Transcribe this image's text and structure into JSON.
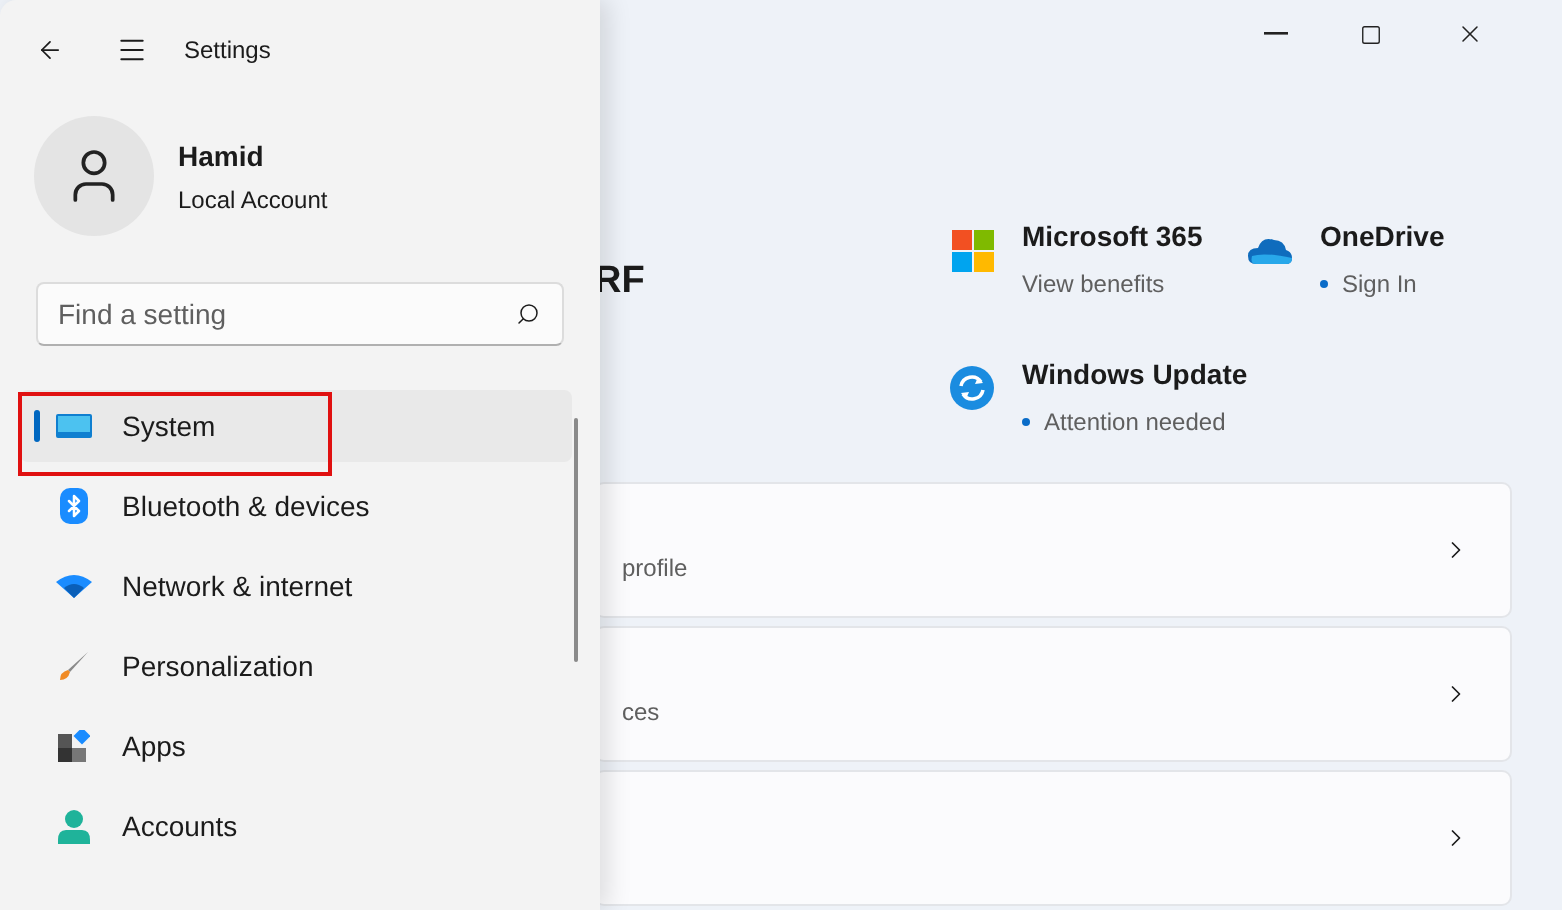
{
  "window": {
    "title": "Settings"
  },
  "account": {
    "name": "Hamid",
    "type": "Local Account"
  },
  "search": {
    "placeholder": "Find a setting"
  },
  "nav": [
    {
      "label": "System",
      "kind": "system",
      "selected": true
    },
    {
      "label": "Bluetooth & devices",
      "kind": "bluetooth",
      "selected": false
    },
    {
      "label": "Network & internet",
      "kind": "network",
      "selected": false
    },
    {
      "label": "Personalization",
      "kind": "brush",
      "selected": false
    },
    {
      "label": "Apps",
      "kind": "apps",
      "selected": false
    },
    {
      "label": "Accounts",
      "kind": "accounts",
      "selected": false
    }
  ],
  "heading": "RF",
  "tiles": [
    {
      "title": "Microsoft 365",
      "status": "View benefits",
      "kind": "squares",
      "dot": false
    },
    {
      "title": "OneDrive",
      "status": "Sign In",
      "kind": "cloud",
      "dot": true
    },
    {
      "title": "Windows Update",
      "status": "Attention needed",
      "kind": "update",
      "dot": true
    }
  ],
  "cards": [
    {
      "kind": "subtitled",
      "subtitle": "profile"
    },
    {
      "kind": "subtitled",
      "subtitle": "ces"
    },
    {
      "kind": "plain"
    }
  ]
}
